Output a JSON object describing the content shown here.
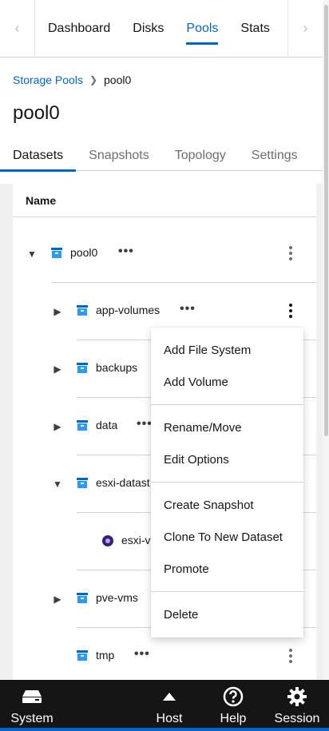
{
  "nav": {
    "items": [
      {
        "label": "Dashboard",
        "active": false
      },
      {
        "label": "Disks",
        "active": false
      },
      {
        "label": "Pools",
        "active": true
      },
      {
        "label": "Stats",
        "active": false
      }
    ],
    "scroll_left_icon": "chevron-left-icon",
    "scroll_right_icon": "chevron-right-icon"
  },
  "breadcrumb": {
    "parent": "Storage Pools",
    "current": "pool0"
  },
  "page": {
    "title": "pool0"
  },
  "tabs": [
    {
      "label": "Datasets",
      "active": true
    },
    {
      "label": "Snapshots",
      "active": false
    },
    {
      "label": "Topology",
      "active": false
    },
    {
      "label": "Settings",
      "active": false
    }
  ],
  "table": {
    "column_name": "Name",
    "rows": [
      {
        "label": "pool0",
        "expanded": true,
        "type": "dataset"
      },
      {
        "label": "app-volumes",
        "expanded": false,
        "type": "dataset",
        "menu_open": true
      },
      {
        "label": "backups",
        "expanded": false,
        "type": "dataset"
      },
      {
        "label": "data",
        "expanded": false,
        "type": "dataset"
      },
      {
        "label": "esxi-datast",
        "expanded": true,
        "type": "dataset"
      },
      {
        "label": "esxi-v",
        "type": "volume"
      },
      {
        "label": "pve-vms",
        "expanded": false,
        "type": "dataset"
      },
      {
        "label": "tmp",
        "expanded": false,
        "type": "dataset"
      }
    ]
  },
  "menu": {
    "groups": [
      [
        "Add File System",
        "Add Volume"
      ],
      [
        "Rename/Move",
        "Edit Options"
      ],
      [
        "Create Snapshot",
        "Clone To New Dataset",
        "Promote"
      ],
      [
        "Delete"
      ]
    ]
  },
  "bottombar": {
    "items": [
      {
        "label": "System",
        "icon": "system-icon"
      },
      {
        "label": "Host",
        "icon": "caret-up-icon"
      },
      {
        "label": "Help",
        "icon": "help-icon"
      },
      {
        "label": "Session",
        "icon": "gear-icon"
      }
    ],
    "accent_color": "#0066cc",
    "background_color": "#151515"
  },
  "colors": {
    "link": "#0066cc",
    "dataset_icon": "#2b9af3",
    "volume_icon": "#3c1c7a"
  }
}
